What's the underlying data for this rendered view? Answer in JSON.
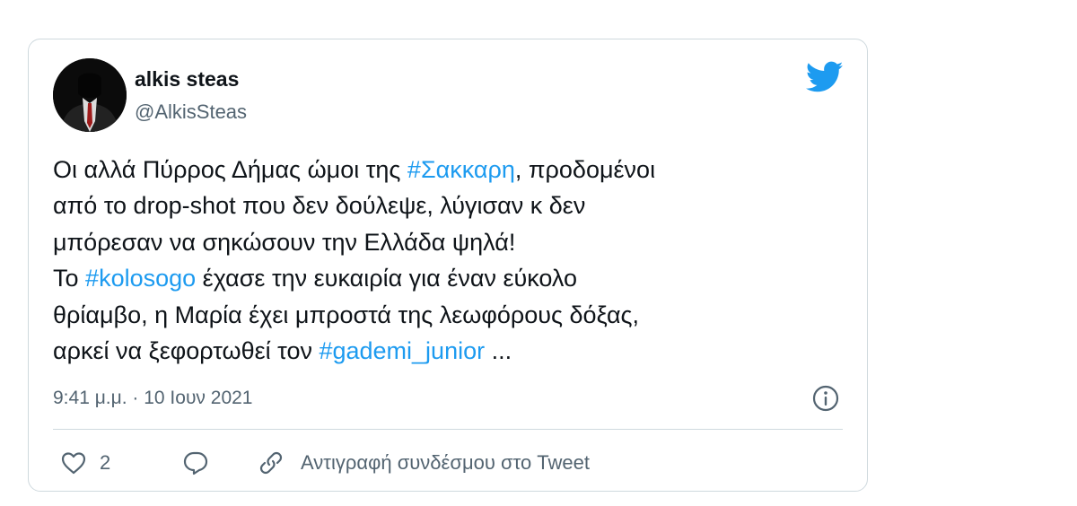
{
  "user": {
    "name": "alkis steas",
    "handle": "@AlkisSteas"
  },
  "tweet": {
    "line1": {
      "a": "Οι αλλά Πύρρος Δήμας ώμοι της ",
      "tag": "#Σακκαρη",
      "b": ", προδομένοι"
    },
    "line2": "από το drop-shot που δεν δούλεψε, λύγισαν κ δεν",
    "line3": "μπόρεσαν να σηκώσουν την Ελλάδα ψηλά!",
    "line4": {
      "a": "Το ",
      "tag": "#kolosogo",
      "b": " έχασε την ευκαιρία για έναν εύκολο"
    },
    "line5": "θρίαμβο, η Μαρία έχει μπροστά της λεωφόρους δόξας,",
    "line6": {
      "a": "αρκεί να ξεφορτωθεί τον ",
      "tag": "#gademi_junior",
      "b": " ..."
    }
  },
  "timestamp": "9:41 μ.μ. · 10 Ιουν 2021",
  "actions": {
    "like_count": "2",
    "copy_link_label": "Αντιγραφή συνδέσμου στο Tweet"
  },
  "colors": {
    "accent": "#1d9bf0",
    "secondary_text": "#536471",
    "border": "#cfd9de"
  },
  "icons": [
    "twitter-bird-icon",
    "info-icon",
    "heart-icon",
    "reply-icon",
    "link-icon"
  ]
}
